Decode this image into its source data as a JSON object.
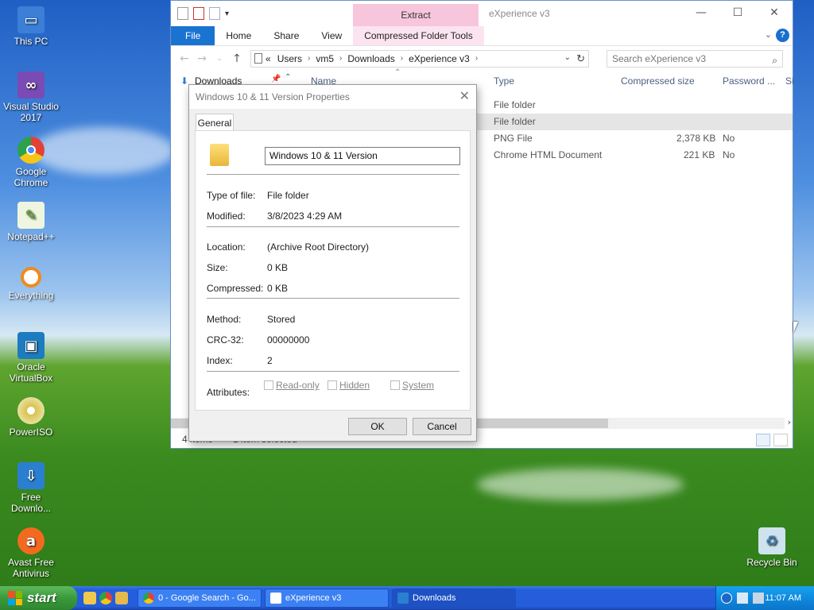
{
  "desktop": {
    "icons": [
      {
        "label": "This PC",
        "icon": "computer-icon",
        "color": "#3b7fd6"
      },
      {
        "label": "Visual Studio 2017",
        "icon": "visual-studio-icon",
        "color": "#7a4bb5"
      },
      {
        "label": "Google Chrome",
        "icon": "chrome-icon",
        "color": "#e24236"
      },
      {
        "label": "Notepad++",
        "icon": "notepadpp-icon",
        "color": "#7fb34b"
      },
      {
        "label": "Everything",
        "icon": "everything-icon",
        "color": "#f08a1d"
      },
      {
        "label": "Oracle VirtualBox",
        "icon": "virtualbox-icon",
        "color": "#1d7bbf"
      },
      {
        "label": "PowerISO",
        "icon": "poweriso-icon",
        "color": "#d8c24a"
      },
      {
        "label": "Free Downlo...",
        "icon": "free-download-icon",
        "color": "#2a7fd1"
      },
      {
        "label": "Avast Free Antivirus",
        "icon": "avast-icon",
        "color": "#f26a1f"
      }
    ],
    "recycle_bin": "Recycle Bin"
  },
  "explorer": {
    "title": "eXperience v3",
    "extract_tab": "Extract",
    "ribbon_tabs": [
      "File",
      "Home",
      "Share",
      "View",
      "Compressed Folder Tools"
    ],
    "address": {
      "crumbs": [
        "Users",
        "vm5",
        "Downloads",
        "eXperience v3"
      ],
      "lead": "«"
    },
    "search_placeholder": "Search eXperience v3",
    "nav_pane_item": "Downloads",
    "columns": {
      "name": "Name",
      "type": "Type",
      "compressed": "Compressed size",
      "password": "Password ...",
      "size": "Si"
    },
    "rows": [
      {
        "type": "File folder",
        "size": "",
        "pw": ""
      },
      {
        "type": "File folder",
        "size": "",
        "pw": ""
      },
      {
        "type": "PNG File",
        "size": "2,378 KB",
        "pw": "No"
      },
      {
        "type": "Chrome HTML Document",
        "size": "221 KB",
        "pw": "No"
      }
    ],
    "status_items": "4 items",
    "status_selected": "1 item selected"
  },
  "dialog": {
    "title": "Windows 10 & 11 Version Properties",
    "tab": "General",
    "name_value": "Windows 10 & 11 Version",
    "props": {
      "type_label": "Type of file:",
      "type_value": "File folder",
      "modified_label": "Modified:",
      "modified_value": "3/8/2023 4:29 AM",
      "location_label": "Location:",
      "location_value": "(Archive Root Directory)",
      "size_label": "Size:",
      "size_value": "0 KB",
      "compressed_label": "Compressed:",
      "compressed_value": "0 KB",
      "method_label": "Method:",
      "method_value": "Stored",
      "crc_label": "CRC-32:",
      "crc_value": "00000000",
      "index_label": "Index:",
      "index_value": "2",
      "attributes_label": "Attributes:"
    },
    "attributes": [
      "Read-only",
      "Hidden",
      "System"
    ],
    "ok": "OK",
    "cancel": "Cancel"
  },
  "taskbar": {
    "start": "start",
    "tasks": [
      "0 - Google Search - Go...",
      "eXperience v3",
      "Downloads"
    ],
    "clock": "11:07 AM"
  }
}
